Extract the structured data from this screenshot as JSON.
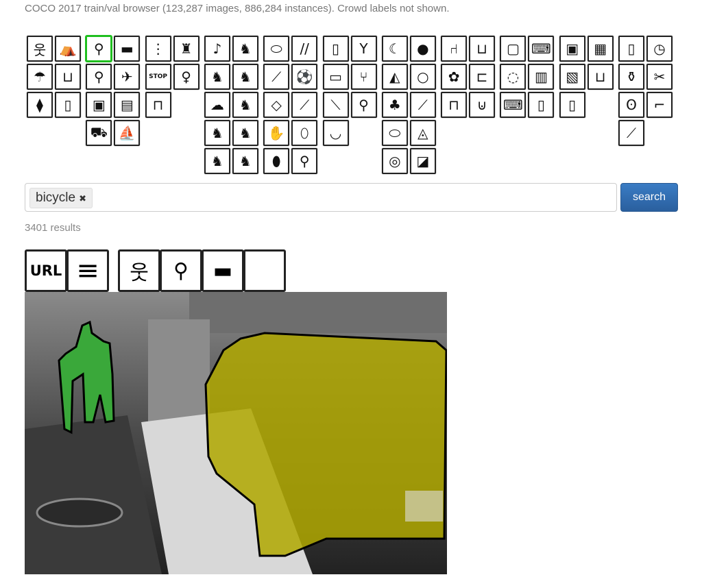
{
  "subtitle": "COCO 2017 train/val browser (123,287 images, 886,284 instances). Crowd labels not shown.",
  "category_groups": [
    [
      [
        "person",
        "🚶",
        "웃"
      ],
      [
        "backpack",
        "🎒",
        "⛺"
      ],
      [
        "umbrella",
        "☂"
      ],
      [
        "handbag",
        "👜",
        "⊔"
      ],
      [
        "tie",
        "⧫"
      ],
      [
        "suitcase",
        "▯"
      ]
    ],
    [
      [
        "bicycle",
        "🚲",
        "⚲"
      ],
      [
        "car",
        "🚗",
        "▬"
      ],
      [
        "motorcycle",
        "🏍",
        "⚲"
      ],
      [
        "airplane",
        "✈"
      ],
      [
        "bus",
        "▣"
      ],
      [
        "train",
        "🚆",
        "▤"
      ],
      [
        "truck",
        "⛟"
      ],
      [
        "boat",
        "⛵"
      ]
    ],
    [
      [
        "traffic light",
        "⋮"
      ],
      [
        "fire hydrant",
        "♜"
      ],
      [
        "stop sign",
        "STOP"
      ],
      [
        "parking meter",
        "♀"
      ],
      [
        "bench",
        "⊓"
      ]
    ],
    [
      [
        "bird",
        "🐦",
        "♪"
      ],
      [
        "cat",
        "🐈",
        "♞"
      ],
      [
        "dog",
        "🐕",
        "♞"
      ],
      [
        "horse",
        "♞"
      ],
      [
        "sheep",
        "🐑",
        "☁"
      ],
      [
        "cow",
        "🐄",
        "♞"
      ],
      [
        "elephant",
        "🐘",
        "♞"
      ],
      [
        "bear",
        "🐻",
        "♞"
      ],
      [
        "zebra",
        "♞"
      ],
      [
        "giraffe",
        "♞"
      ]
    ],
    [
      [
        "frisbee",
        "⬭"
      ],
      [
        "skis",
        "//"
      ],
      [
        "snowboard",
        "⟋"
      ],
      [
        "sports ball",
        "⚽"
      ],
      [
        "kite",
        "◇"
      ],
      [
        "baseball bat",
        "⟋"
      ],
      [
        "baseball glove",
        "✋"
      ],
      [
        "skateboard",
        "⬯"
      ],
      [
        "surfboard",
        "⬮"
      ],
      [
        "tennis racket",
        "⚲"
      ]
    ],
    [
      [
        "bottle",
        "▯"
      ],
      [
        "wine glass",
        "🍷",
        "Y"
      ],
      [
        "cup",
        "▭"
      ],
      [
        "fork",
        "⑂"
      ],
      [
        "knife",
        "⟍"
      ],
      [
        "spoon",
        "⚲"
      ],
      [
        "bowl",
        "◡"
      ]
    ],
    [
      [
        "banana",
        "☾"
      ],
      [
        "apple",
        "🍎",
        "●"
      ],
      [
        "sandwich",
        "◭"
      ],
      [
        "orange",
        "○"
      ],
      [
        "broccoli",
        "♣"
      ],
      [
        "carrot",
        "⟋"
      ],
      [
        "hot dog",
        "⬭"
      ],
      [
        "pizza",
        "◬"
      ],
      [
        "donut",
        "◎"
      ],
      [
        "cake",
        "◪"
      ]
    ],
    [
      [
        "chair",
        "⑁"
      ],
      [
        "couch",
        "⊔"
      ],
      [
        "potted plant",
        "✿"
      ],
      [
        "bed",
        "⊏"
      ],
      [
        "dining table",
        "⊓"
      ],
      [
        "toilet",
        "🚽",
        "⊍"
      ]
    ],
    [
      [
        "tv",
        "📺",
        "▢"
      ],
      [
        "laptop",
        "💻",
        "⌨"
      ],
      [
        "mouse",
        "🖱",
        "◌"
      ],
      [
        "remote",
        "▥"
      ],
      [
        "keyboard",
        "⌨"
      ],
      [
        "cell phone",
        "📱",
        "▯"
      ]
    ],
    [
      [
        "microwave",
        "▣"
      ],
      [
        "oven",
        "▦"
      ],
      [
        "toaster",
        "▧"
      ],
      [
        "sink",
        "⊔"
      ],
      [
        "refrigerator",
        "▯"
      ]
    ],
    [
      [
        "book",
        "📕",
        "▯"
      ],
      [
        "clock",
        "◷"
      ],
      [
        "vase",
        "⚱"
      ],
      [
        "scissors",
        "✂"
      ],
      [
        "teddy bear",
        "🧸",
        "ʘ"
      ],
      [
        "hair drier",
        "⌐"
      ],
      [
        "toothbrush",
        "⟋"
      ]
    ]
  ],
  "group_rows": [
    [
      2,
      2,
      2
    ],
    [
      2,
      2,
      2,
      2
    ],
    [
      2,
      2,
      1
    ],
    [
      2,
      2,
      2,
      2,
      2
    ],
    [
      2,
      2,
      2,
      2,
      2
    ],
    [
      2,
      2,
      2,
      1
    ],
    [
      2,
      2,
      2,
      2,
      2
    ],
    [
      2,
      2,
      2
    ],
    [
      2,
      2,
      2
    ],
    [
      2,
      2,
      1
    ],
    [
      2,
      2,
      2,
      1
    ]
  ],
  "selected_category": "bicycle",
  "search": {
    "tag": "bicycle",
    "tag_remove": "✖",
    "button": "search"
  },
  "results_count": "3401 results",
  "result": {
    "url_label": "URL",
    "caption_icon": "≡",
    "categories": [
      "웃",
      "⚲",
      "▬",
      ""
    ]
  },
  "colors": {
    "selected": "#1fbf1f",
    "button": "#2f6eb4",
    "car_mask": "#b0a800",
    "person_mask": "#3aa83a"
  }
}
